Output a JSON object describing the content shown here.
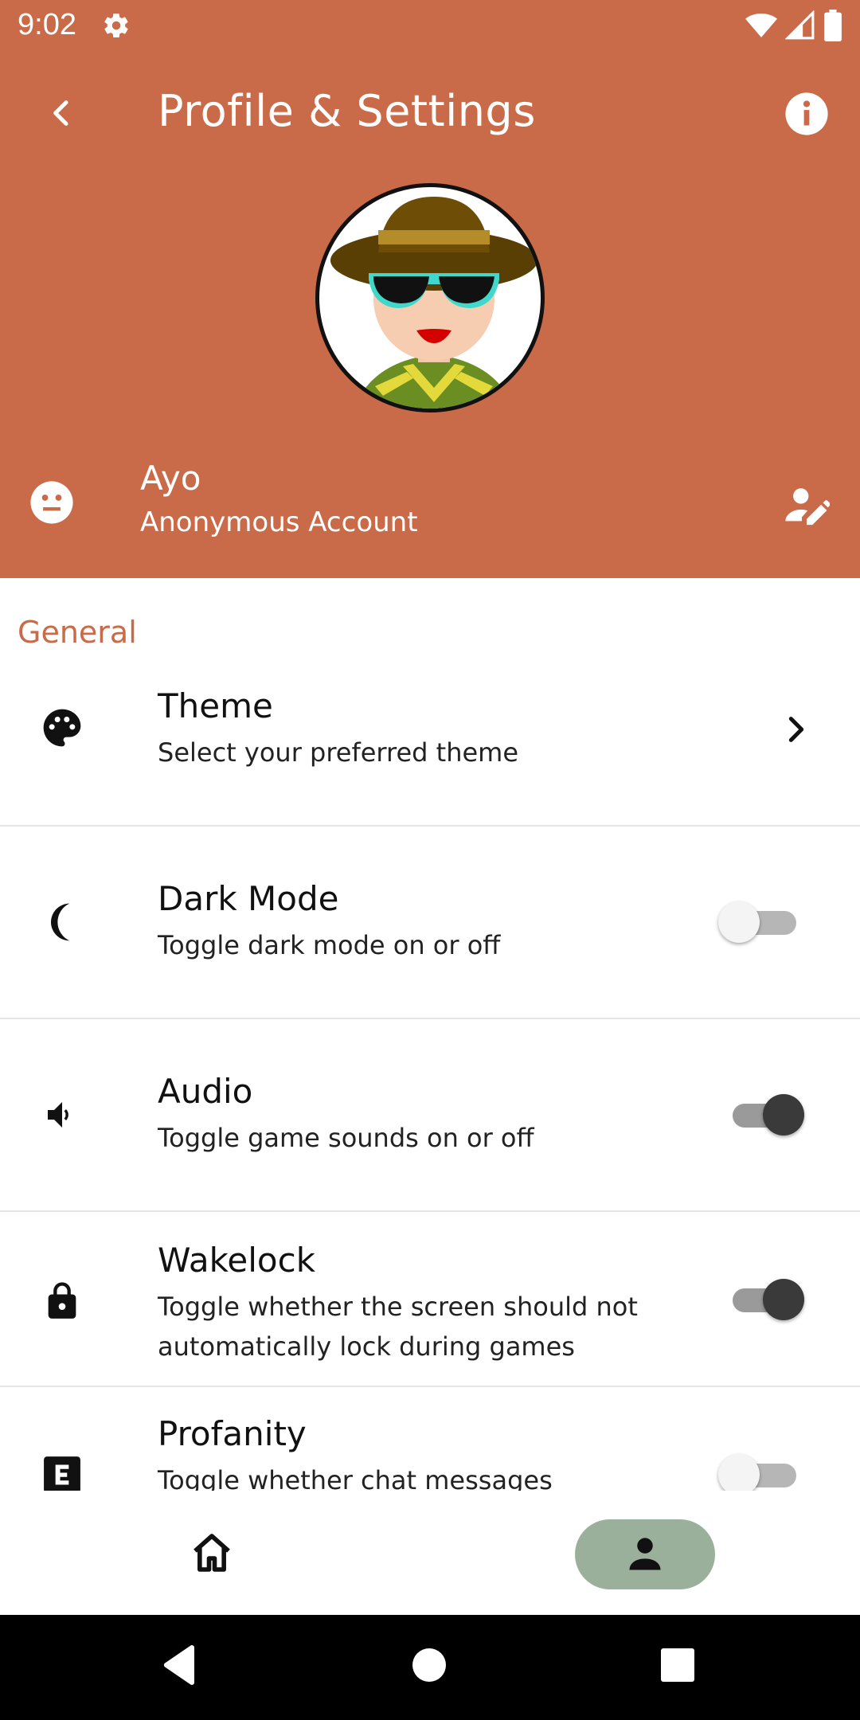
{
  "status_bar": {
    "time": "9:02"
  },
  "header": {
    "title": "Profile & Settings",
    "user_name": "Ayo",
    "account_type": "Anonymous Account"
  },
  "sections": [
    {
      "title": "General",
      "items": [
        {
          "title": "Theme",
          "description": "Select your preferred theme",
          "control": "chevron"
        },
        {
          "title": "Dark Mode",
          "description": "Toggle dark mode on or off",
          "control": "toggle",
          "enabled": false
        },
        {
          "title": "Audio",
          "description": "Toggle game sounds on or off",
          "control": "toggle",
          "enabled": true
        },
        {
          "title": "Wakelock",
          "description": "Toggle whether the screen should not automatically lock during games",
          "control": "toggle",
          "enabled": true
        },
        {
          "title": "Profanity",
          "description": "Toggle whether chat messages",
          "control": "toggle",
          "enabled": false
        }
      ]
    }
  ],
  "bottom_nav": {
    "items": [
      {
        "icon": "home-icon",
        "selected": false
      },
      {
        "icon": "person-icon",
        "selected": true
      }
    ]
  },
  "colors": {
    "header_bg": "#c96a48",
    "accent": "#c96a48",
    "nav_selected_bg": "#9ab09a"
  }
}
